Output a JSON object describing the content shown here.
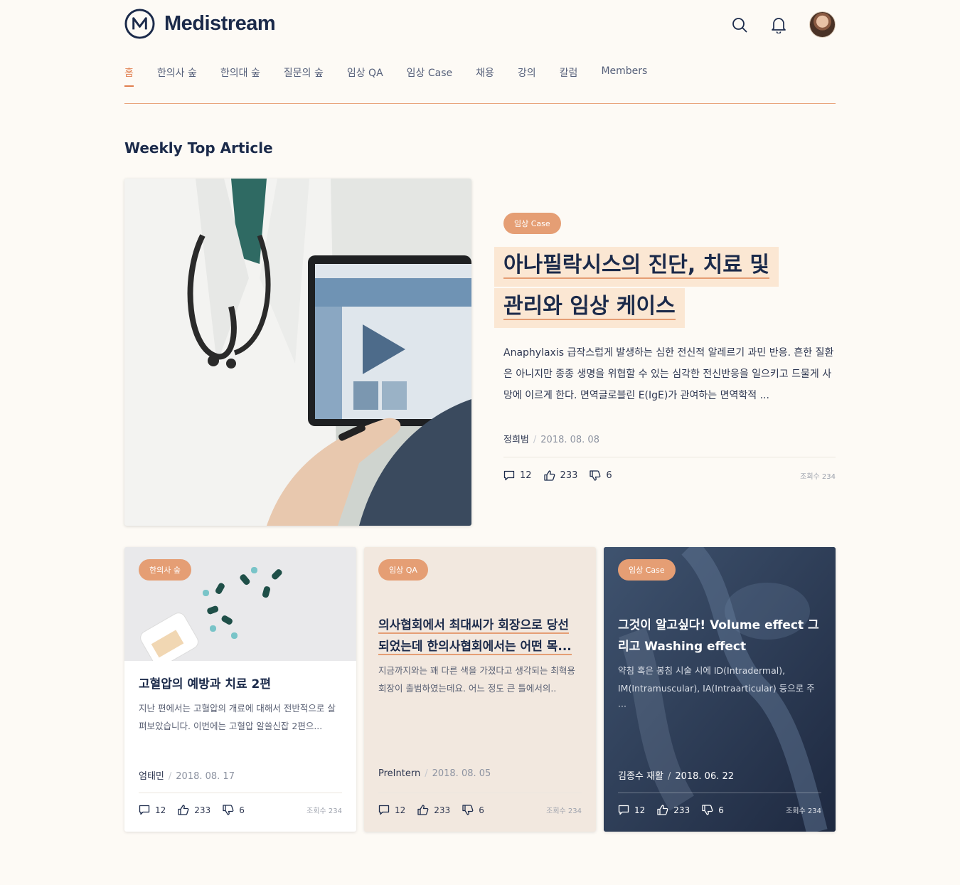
{
  "brand": {
    "name": "Medistream"
  },
  "nav": {
    "items": [
      "홈",
      "한의사 숲",
      "한의대 숲",
      "질문의 숲",
      "임상 QA",
      "임상 Case",
      "채용",
      "강의",
      "칼럼",
      "Members"
    ],
    "active_index": 0
  },
  "section_title": "Weekly Top Article",
  "featured": {
    "tag": "임상 Case",
    "title_line1": "아나필락시스의 진단, 치료 및",
    "title_line2": "관리와 임상 케이스",
    "description": "Anaphylaxis 급작스럽게 발생하는 심한 전신적 알레르기 과민 반응. 흔한 질환은 아니지만 종종 생명을 위협할 수 있는 심각한 전신반응을 일으키고 드물게 사망에 이르게 한다. 면역글로블린 E(IgE)가 관여하는 면역학적 ...",
    "author": "정희범",
    "date": "2018. 08. 08",
    "comments": "12",
    "likes": "233",
    "dislikes": "6",
    "views": "조회수 234"
  },
  "cards": [
    {
      "tag": "한의사 숲",
      "title": "고혈압의 예방과 치료 2편",
      "description": "지난 편에서는 고혈압의 개료에 대해서 전반적으로 살펴보았습니다. 이번에는 고혈압 알쓸신잡 2편으...",
      "author": "엄태민",
      "date": "2018. 08. 17",
      "comments": "12",
      "likes": "233",
      "dislikes": "6",
      "views": "조회수 234"
    },
    {
      "tag": "임상 QA",
      "title_line1": "의사협회에서 최대씨가 회장으로 당선",
      "title_line2": "되었는데 한의사협회에서는 어떤 목...",
      "description": "지금까지와는 꽤 다른 색을 가졌다고 생각되는 최혁용 회장이 출범하였는데요. 어느 정도 큰 틀에서의..",
      "author": "PreIntern",
      "date": "2018. 08. 05",
      "comments": "12",
      "likes": "233",
      "dislikes": "6",
      "views": "조회수 234"
    },
    {
      "tag": "임상 Case",
      "title": "그것이 알고싶다! Volume effect 그리고 Washing effect",
      "description": "약침 혹은 봉침 시술 시에 ID(Intradermal), IM(Intramuscular), IA(Intraarticular) 등으로 주···",
      "author": "김종수 재활",
      "date": "2018. 06. 22",
      "comments": "12",
      "likes": "233",
      "dislikes": "6",
      "views": "조회수 234"
    }
  ],
  "colors": {
    "accent": "#e59e74",
    "navy": "#1b2a4a",
    "background": "#fdfaf5"
  },
  "icons": {
    "search": "search-icon",
    "notifications": "bell-icon",
    "comment": "comment-icon",
    "like": "thumbs-up-icon",
    "dislike": "thumbs-down-icon"
  }
}
